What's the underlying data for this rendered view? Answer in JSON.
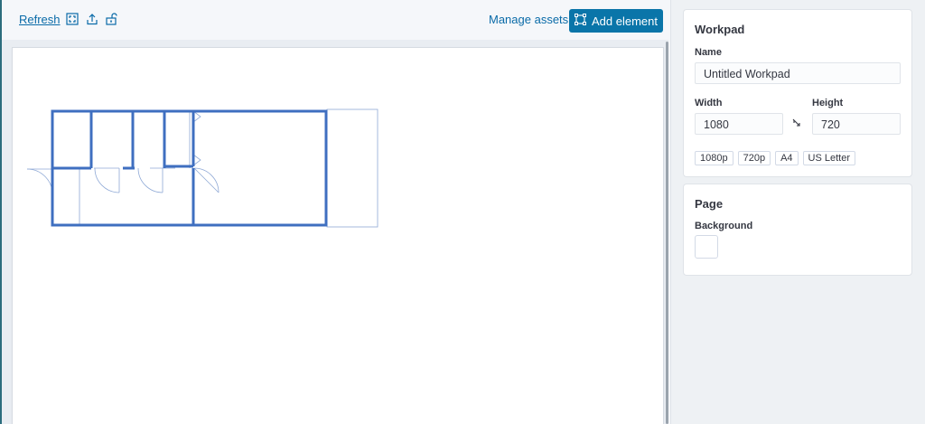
{
  "toolbar": {
    "refresh_label": "Refresh",
    "icons": [
      "fullscreen-icon",
      "share-icon",
      "lock-icon"
    ],
    "manage_assets_label": "Manage assets",
    "add_element_label": "Add element"
  },
  "sidebar": {
    "workpad": {
      "title": "Workpad",
      "name_label": "Name",
      "name_value": "Untitled Workpad",
      "width_label": "Width",
      "width_value": "1080",
      "height_label": "Height",
      "height_value": "720",
      "presets": [
        "1080p",
        "720p",
        "A4",
        "US Letter"
      ]
    },
    "page": {
      "title": "Page",
      "background_label": "Background",
      "background_color": "#ffffff"
    }
  },
  "colors": {
    "accent": "#0a75a9",
    "link": "#0a6ba8",
    "floorplan_wall": "#3f6fc0",
    "floorplan_thin": "#8fa9d6"
  }
}
